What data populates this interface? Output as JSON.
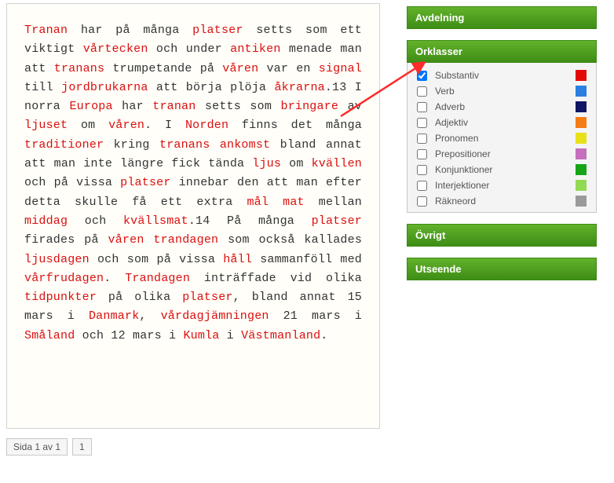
{
  "text_tokens": [
    {
      "t": "Tranan",
      "h": 1
    },
    {
      "t": " har på många "
    },
    {
      "t": "platser",
      "h": 1
    },
    {
      "t": " setts som ett viktigt "
    },
    {
      "t": "vårtecken",
      "h": 1
    },
    {
      "t": " och under "
    },
    {
      "t": "antiken",
      "h": 1
    },
    {
      "t": " menade man att "
    },
    {
      "t": "tranans",
      "h": 1
    },
    {
      "t": " trumpetande på "
    },
    {
      "t": "våren",
      "h": 1
    },
    {
      "t": " var en "
    },
    {
      "t": "signal",
      "h": 1
    },
    {
      "t": " till "
    },
    {
      "t": "jordbrukarna",
      "h": 1
    },
    {
      "t": " att börja plöja "
    },
    {
      "t": "åkrarna",
      "h": 1
    },
    {
      "t": ".13 I norra "
    },
    {
      "t": "Europa",
      "h": 1
    },
    {
      "t": " har "
    },
    {
      "t": "tranan",
      "h": 1
    },
    {
      "t": " setts som "
    },
    {
      "t": "bringare",
      "h": 1
    },
    {
      "t": " av "
    },
    {
      "t": "ljuset",
      "h": 1
    },
    {
      "t": " om "
    },
    {
      "t": "våren",
      "h": 1
    },
    {
      "t": ". I "
    },
    {
      "t": "Norden",
      "h": 1
    },
    {
      "t": " finns det många "
    },
    {
      "t": "traditioner",
      "h": 1
    },
    {
      "t": " kring "
    },
    {
      "t": "tranans",
      "h": 1
    },
    {
      "t": " "
    },
    {
      "t": "ankomst",
      "h": 1
    },
    {
      "t": " bland annat att man inte längre fick tända "
    },
    {
      "t": "ljus",
      "h": 1
    },
    {
      "t": " om "
    },
    {
      "t": "kvällen",
      "h": 1
    },
    {
      "t": " och på vissa "
    },
    {
      "t": "platser",
      "h": 1
    },
    {
      "t": " innebar den att man efter detta skulle få ett extra "
    },
    {
      "t": "mål",
      "h": 1
    },
    {
      "t": " "
    },
    {
      "t": "mat",
      "h": 1
    },
    {
      "t": " mellan "
    },
    {
      "t": "middag",
      "h": 1
    },
    {
      "t": " och "
    },
    {
      "t": "kvällsmat",
      "h": 1
    },
    {
      "t": ".14 På många "
    },
    {
      "t": "platser",
      "h": 1
    },
    {
      "t": " firades på "
    },
    {
      "t": "våren",
      "h": 1
    },
    {
      "t": " "
    },
    {
      "t": "trandagen",
      "h": 1
    },
    {
      "t": " som också kallades "
    },
    {
      "t": "ljusdagen",
      "h": 1
    },
    {
      "t": " och som på vissa "
    },
    {
      "t": "håll",
      "h": 1
    },
    {
      "t": " sammanföll med "
    },
    {
      "t": "vårfrudagen",
      "h": 1
    },
    {
      "t": ". "
    },
    {
      "t": "Trandagen",
      "h": 1
    },
    {
      "t": " inträffade vid olika "
    },
    {
      "t": "tidpunkter",
      "h": 1
    },
    {
      "t": " på olika "
    },
    {
      "t": "platser",
      "h": 1
    },
    {
      "t": ", bland annat 15 mars i "
    },
    {
      "t": "Danmark",
      "h": 1
    },
    {
      "t": ", "
    },
    {
      "t": "vårdagjämningen",
      "h": 1
    },
    {
      "t": " 21 mars i "
    },
    {
      "t": "Småland",
      "h": 1
    },
    {
      "t": " och 12 mars i "
    },
    {
      "t": "Kumla",
      "h": 1
    },
    {
      "t": " i "
    },
    {
      "t": "Västmanland",
      "h": 1
    },
    {
      "t": "."
    }
  ],
  "pager": {
    "text": "Sida 1 av 1",
    "page": "1"
  },
  "panels": {
    "avdelning": "Avdelning",
    "orklasser": "Orklasser",
    "ovrigt": "Övrigt",
    "utseende": "Utseende"
  },
  "classes": [
    {
      "label": "Substantiv",
      "checked": true,
      "color": "#e30909"
    },
    {
      "label": "Verb",
      "checked": false,
      "color": "#2a7fe0"
    },
    {
      "label": "Adverb",
      "checked": false,
      "color": "#101663"
    },
    {
      "label": "Adjektiv",
      "checked": false,
      "color": "#f37c15"
    },
    {
      "label": "Pronomen",
      "checked": false,
      "color": "#e8e11a"
    },
    {
      "label": "Prepositioner",
      "checked": false,
      "color": "#c66fbd"
    },
    {
      "label": "Konjunktioner",
      "checked": false,
      "color": "#18a418"
    },
    {
      "label": "Interjektioner",
      "checked": false,
      "color": "#93d953"
    },
    {
      "label": "Räkneord",
      "checked": false,
      "color": "#9a9a9a"
    }
  ]
}
